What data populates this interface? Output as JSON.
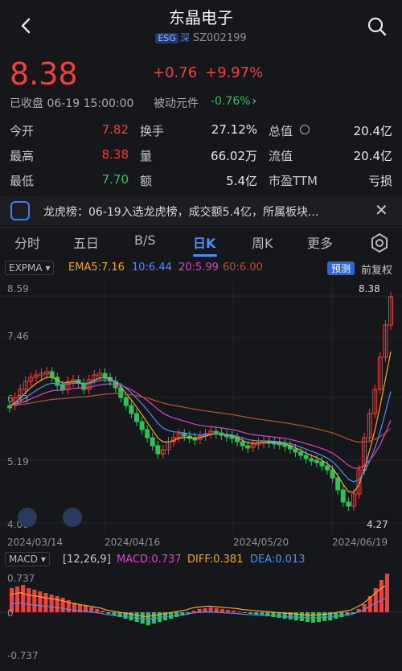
{
  "header": {
    "title": "东晶电子",
    "esg": "ESG",
    "market": "深",
    "code": "SZ002199"
  },
  "quote": {
    "price": "8.38",
    "change": "+0.76",
    "change_pct": "+9.97%",
    "status": "已收盘 06-19 15:00:00",
    "passive_label": "被动元件",
    "passive_value": "-0.76%"
  },
  "stats": [
    {
      "label": "今开",
      "value": "7.82",
      "label2": "换手",
      "value2": "27.12%",
      "label3": "总值",
      "value3": "20.4亿"
    },
    {
      "label": "最高",
      "value": "8.38",
      "label2": "量",
      "value2": "66.02万",
      "label3": "流值",
      "value3": "20.4亿"
    },
    {
      "label": "最低",
      "value": "7.70",
      "label2": "额",
      "value2": "5.4亿",
      "label3": "市盈TTM",
      "value3": "亏损"
    }
  ],
  "banner": {
    "text": "龙虎榜：06-19入选龙虎榜，成交额5.4亿，所属板块..."
  },
  "tabs": [
    "分时",
    "五日",
    "B/S",
    "日K",
    "周K",
    "更多"
  ],
  "active_tab": "日K",
  "indicators": {
    "expma": "EXPMA",
    "ema5": "EMA5:7.16",
    "ema10": "10:6.44",
    "ema20": "20:5.99",
    "ema60": "60:6.00",
    "forecast": "预测",
    "adjust": "前复权"
  },
  "price_axis": [
    "8.59",
    "7.46",
    "6.33",
    "5.19",
    "4.06"
  ],
  "price_marks": {
    "high": "8.38",
    "low": "4.27"
  },
  "dates": [
    "2024/03/14",
    "2024/04/16",
    "2024/05/20",
    "2024/06/19"
  ],
  "macd": {
    "label": "MACD",
    "params": "[12,26,9]",
    "macd": "MACD:0.737",
    "diff": "DIFF:0.381",
    "dea": "DEA:0.013",
    "axis_top": "0.737",
    "axis_zero": "0",
    "axis_bottom": "-0.737"
  },
  "colors": {
    "up": "#f0403d",
    "down": "#2ec25d",
    "accent": "#4c8ef7",
    "ema5": "#f5a623",
    "ema10": "#4c8ef7",
    "ema20": "#e040c8",
    "ema60": "#b3552a"
  }
}
